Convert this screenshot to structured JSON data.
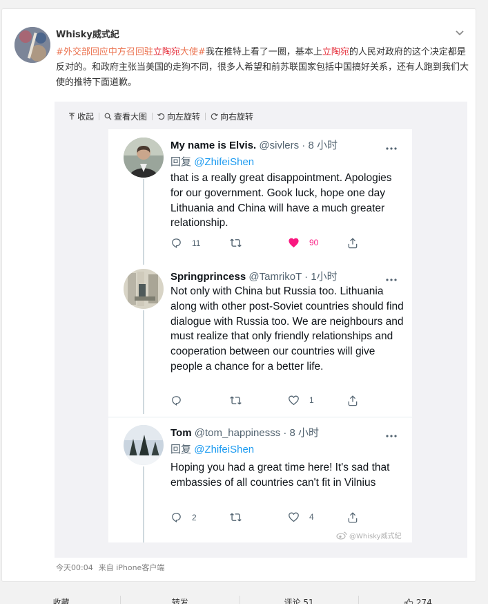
{
  "post": {
    "username": "Whisky威式紀",
    "text_segments": [
      {
        "text": "#外交部回应中方召回驻",
        "style": "topic"
      },
      {
        "text": "立陶宛",
        "style": "hl"
      },
      {
        "text": "大使#",
        "style": "topic"
      },
      {
        "text": "我在推特上看了一圈，基本上",
        "style": "plain"
      },
      {
        "text": "立陶宛",
        "style": "hl"
      },
      {
        "text": "的人民对政府的这个决定都是反对的。和政府主张当美国的走狗不同，很多人希望和前苏联国家包括中国搞好关系，还有人跑到我们大使的推特下面道歉。",
        "style": "plain"
      }
    ],
    "time": "今天00:04",
    "source": "来自 iPhone客户端"
  },
  "toolbar": {
    "collapse": "收起",
    "view_large": "查看大图",
    "rotate_left": "向左旋转",
    "rotate_right": "向右旋转"
  },
  "tweets": [
    {
      "name": "My name is Elvis.",
      "handle": "@sivlers · 8 小时",
      "reply_prefix": "回复",
      "reply_to": "@ZhifeiShen",
      "text": "that is a really great disappointment. Apologies for our government. Gook luck, hope one day Lithuania and China will have a much greater relationship.",
      "replies": "11",
      "retweets": "",
      "likes": "90",
      "liked": true
    },
    {
      "name": "Springprincess",
      "handle": "@TamrikoT · 1小时",
      "text": "Not only with China but Russia too. Lithuania along with other post-Soviet countries should find dialogue with Russia too. We are neighbours and must realize that only friendly relationships and cooperation between our countries will give people a chance for a better life.",
      "replies": "",
      "retweets": "",
      "likes": "1",
      "liked": false
    },
    {
      "name": "Tom",
      "handle": "@tom_happinesss · 8 小时",
      "reply_prefix": "回复",
      "reply_to": "@ZhifeiShen",
      "text": "Hoping you had a great time here! It's sad that embassies of all countries can't fit in Vilnius",
      "replies": "2",
      "retweets": "",
      "likes": "4",
      "liked": false
    }
  ],
  "watermark": "@Whisky威式紀",
  "actions": {
    "favorite": "收藏",
    "repost": "转发",
    "comment": "评论 51",
    "like": "274"
  },
  "colors": {
    "topic": "#eb7350",
    "highlight": "#e5333f",
    "twitter_blue": "#1d9bf0",
    "like_pink": "#f91880"
  }
}
